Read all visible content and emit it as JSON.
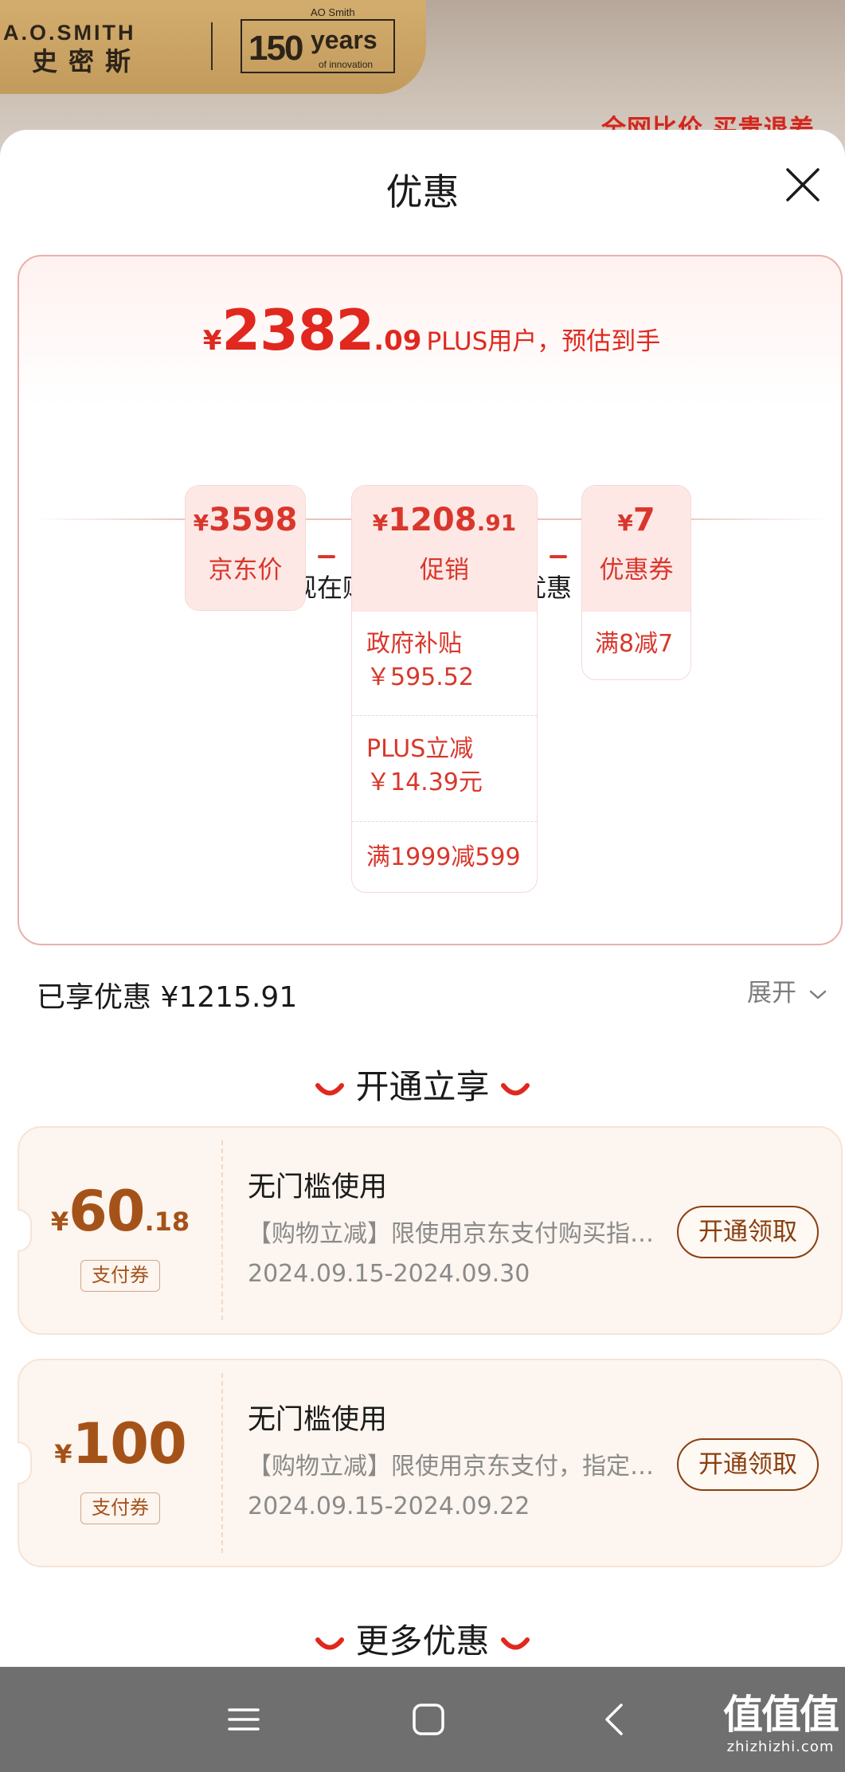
{
  "banner": {
    "brand_en": "A.O.SMITH",
    "brand_cn": "史密斯",
    "years_top": "AO Smith",
    "years_number": "150",
    "years_word": "years",
    "years_sub": "of innovation",
    "slogan": "全网比价 买贵退差"
  },
  "sheet": {
    "title": "优惠",
    "close_icon": "close-icon"
  },
  "summary": {
    "currency": "¥",
    "estimated_int": "2382",
    "estimated_dec": ".09",
    "estimated_note": "PLUS用户，预估到手",
    "enjoy_text": "现在购买，享受以下优惠",
    "jd_price": {
      "currency": "¥",
      "amount": "3598",
      "label": "京东价"
    },
    "promotion": {
      "currency": "¥",
      "amount": "1208",
      "decimal": ".91",
      "label": "促销",
      "items": [
        {
          "name": "政府补贴",
          "value": "￥595.52"
        },
        {
          "name": "PLUS立减",
          "value": "￥14.39元"
        },
        {
          "name": "满1999减599",
          "value": ""
        }
      ]
    },
    "coupon": {
      "currency": "¥",
      "amount": "7",
      "label": "优惠券",
      "items": [
        "满8减7"
      ]
    }
  },
  "enjoyed": {
    "text": "已享优惠 ¥1215.91",
    "expand_label": "展开"
  },
  "section_open": {
    "title": "开通立享"
  },
  "coupons": [
    {
      "currency": "¥",
      "amount": "60",
      "decimal": ".18",
      "tag": "支付券",
      "title": "无门槛使用",
      "desc": "【购物立减】限使用京东支付购买指定商品",
      "date": "2024.09.15-2024.09.30",
      "button": "开通领取"
    },
    {
      "currency": "¥",
      "amount": "100",
      "decimal": "",
      "tag": "支付券",
      "title": "无门槛使用",
      "desc": "【购物立减】限使用京东支付，指定商品可用",
      "date": "2024.09.15-2024.09.22",
      "button": "开通领取"
    }
  ],
  "section_more": {
    "title": "更多优惠"
  },
  "navbar": {
    "menu_icon": "menu-icon",
    "home_icon": "home-square-icon",
    "back_icon": "back-chevron-icon",
    "watermark_big": "值值值",
    "watermark_small": "zhizhizhi.com"
  },
  "colors": {
    "price_red": "#e0281e",
    "coupon_brown": "#a55219",
    "button_brown": "#8a3f10"
  }
}
